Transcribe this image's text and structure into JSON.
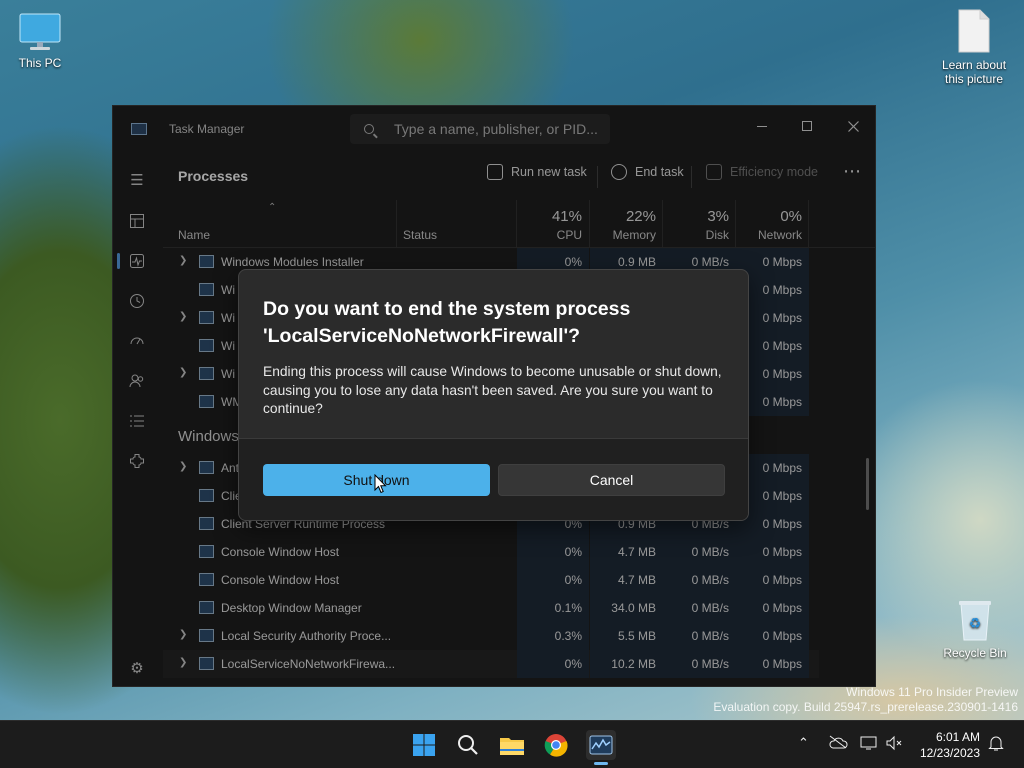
{
  "desktop": {
    "icons": [
      {
        "label": "This PC"
      },
      {
        "label": "Learn about this picture"
      },
      {
        "label": "Recycle Bin"
      }
    ],
    "watermark": {
      "line1": "Windows 11 Pro Insider Preview",
      "line2": "Evaluation copy. Build 25947.rs_prerelease.230901-1416"
    }
  },
  "task_manager": {
    "title": "Task Manager",
    "search_placeholder": "Type a name, publisher, or PID...",
    "heading": "Processes",
    "toolbar": {
      "run_new_task": "Run new task",
      "end_task": "End task",
      "efficiency_mode": "Efficiency mode"
    },
    "columns": {
      "name": "Name",
      "status": "Status",
      "cpu_pct": "41%",
      "cpu": "CPU",
      "memory_pct": "22%",
      "memory": "Memory",
      "disk_pct": "3%",
      "disk": "Disk",
      "network_pct": "0%",
      "network": "Network"
    },
    "group_windows": "Windows",
    "rows_top": [
      {
        "name": "Windows Modules Installer",
        "expand": true,
        "cpu": "0%",
        "memory": "0.9 MB",
        "disk": "0 MB/s",
        "network": "0 Mbps"
      },
      {
        "name": "Wi",
        "expand": false,
        "network": "0 Mbps"
      },
      {
        "name": "Wi",
        "expand": true,
        "network": "0 Mbps"
      },
      {
        "name": "Wi",
        "expand": false,
        "network": "0 Mbps"
      },
      {
        "name": "Wi",
        "expand": true,
        "network": "0 Mbps"
      },
      {
        "name": "WM",
        "expand": false,
        "network": "0 Mbps"
      }
    ],
    "rows_windows": [
      {
        "name": "Ant",
        "expand": true,
        "network": "0 Mbps"
      },
      {
        "name": "Clie",
        "expand": false,
        "network": "0 Mbps"
      },
      {
        "name": "Client Server Runtime Process",
        "expand": false,
        "cpu": "0%",
        "memory": "0.9 MB",
        "disk": "0 MB/s",
        "network": "0 Mbps"
      },
      {
        "name": "Console Window Host",
        "expand": false,
        "cpu": "0%",
        "memory": "4.7 MB",
        "disk": "0 MB/s",
        "network": "0 Mbps"
      },
      {
        "name": "Console Window Host",
        "expand": false,
        "cpu": "0%",
        "memory": "4.7 MB",
        "disk": "0 MB/s",
        "network": "0 Mbps"
      },
      {
        "name": "Desktop Window Manager",
        "expand": false,
        "cpu": "0.1%",
        "memory": "34.0 MB",
        "disk": "0 MB/s",
        "network": "0 Mbps"
      },
      {
        "name": "Local Security Authority Proce...",
        "expand": true,
        "cpu": "0.3%",
        "memory": "5.5 MB",
        "disk": "0 MB/s",
        "network": "0 Mbps"
      },
      {
        "name": "LocalServiceNoNetworkFirewa...",
        "expand": true,
        "cpu": "0%",
        "memory": "10.2 MB",
        "disk": "0 MB/s",
        "network": "0 Mbps"
      }
    ]
  },
  "dialog": {
    "title": "Do you want to end the system process 'LocalServiceNoNetworkFirewall'?",
    "message": "Ending this process will cause Windows to become unusable or shut down, causing you to lose any data hasn't been saved. Are you sure you want to continue?",
    "primary_button": "Shut down",
    "secondary_button": "Cancel"
  },
  "taskbar": {
    "apps": [
      "windows-start-icon",
      "search-icon",
      "file-explorer-icon",
      "chrome-icon",
      "task-manager-icon"
    ],
    "time": "6:01 AM",
    "date": "12/23/2023"
  },
  "colors": {
    "accent": "#4cb1ea",
    "window_bg": "#202020",
    "dialog_bg": "#2b2b2b"
  }
}
